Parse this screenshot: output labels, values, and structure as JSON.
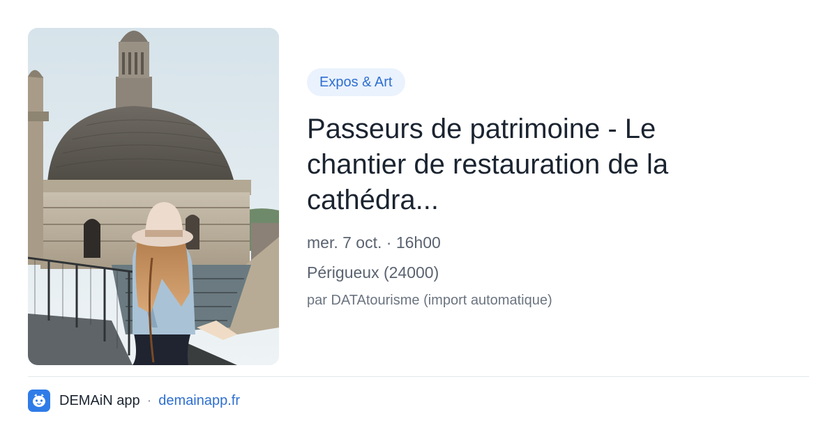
{
  "event": {
    "category": "Expos & Art",
    "title": "Passeurs de patrimoine - Le chantier de restauration de la cathédra...",
    "date": "mer. 7 oct. · 16h00",
    "location": "Périgueux (24000)",
    "source": "par DATAtourisme (import automatique)"
  },
  "footer": {
    "app_name": "DEMAiN app",
    "separator": "·",
    "site": "demainapp.fr"
  },
  "colors": {
    "accent": "#2e6fd0",
    "category_bg": "#eaf2fd",
    "title": "#1b2430",
    "muted": "#5a6370"
  },
  "icons": {
    "app": "demain-app-icon"
  }
}
